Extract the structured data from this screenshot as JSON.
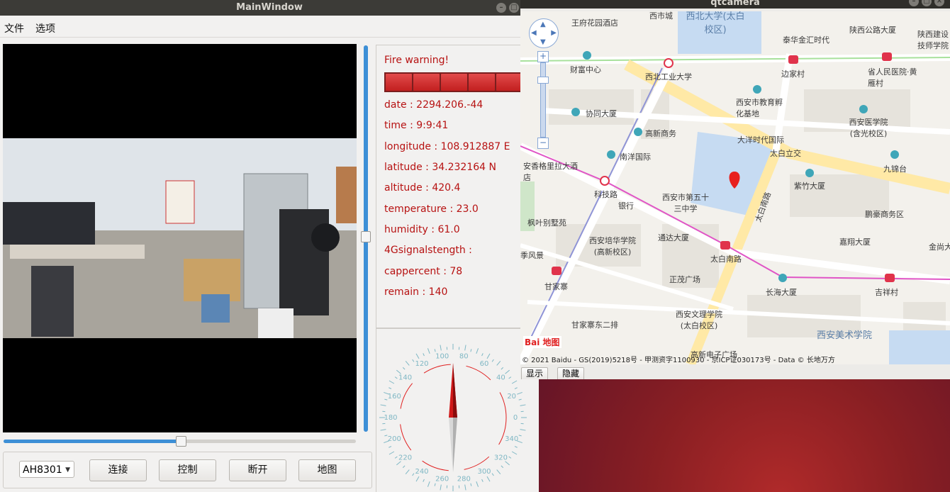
{
  "main_window": {
    "title": "MainWindow",
    "menu": [
      "文件",
      "选项"
    ],
    "info": {
      "fire_warning": "Fire warning!",
      "lines": [
        "date : 2294.206.-44",
        "time : 9:9:41",
        "longitude : 108.912887 E",
        "latitude : 34.232164 N",
        "altitude : 420.4",
        "temperature : 23.0",
        "humidity : 61.0",
        "4Gsignalstength :",
        "cappercent : 78",
        "remain : 140"
      ]
    },
    "device_select": "AH8301",
    "buttons": {
      "connect": "连接",
      "control": "控制",
      "disconnect": "断开",
      "map": "地图"
    },
    "compass": {
      "ticks": [
        "0",
        "20",
        "40",
        "60",
        "80",
        "100",
        "120",
        "140",
        "160",
        "180",
        "200",
        "220",
        "240",
        "260",
        "280",
        "300",
        "320",
        "340"
      ],
      "heading_deg": 0
    },
    "slider_h_fraction": 0.5,
    "slider_v_fraction": 1.0
  },
  "cam_window": {
    "title": "qtcamera",
    "map": {
      "labels": [
        "王府花园酒店",
        "西市城",
        "西北大学(太白校区)",
        "泰华金汇时代",
        "陕西公路大厦",
        "陕西建设技师学院",
        "财富中心",
        "西北工业大学",
        "边家村",
        "省人民医院·黄雁村",
        "西安市教育孵化基地",
        "协同大厦",
        "高新商务",
        "大洋时代国际",
        "西安医学院(含光校区)",
        "南洋国际",
        "太白立交",
        "九锦台",
        "安香格里拉大酒店",
        "科技路",
        "西安市第五十三中学",
        "紫竹大厦",
        "银行",
        "太白南路",
        "鹏豪商务区",
        "枫叶别墅苑",
        "通达大厦",
        "西安培华学院(高新校区)",
        "嘉翔大厦",
        "季风景",
        "太白南路",
        "甘家寨",
        "正茂广场",
        "长海大厦",
        "吉祥村",
        "西安文理学院(太白校区)",
        "甘家寨东二排",
        "西安美术学院",
        "高新电子广场",
        "金尚大"
      ],
      "copyright": "© 2021 Baidu - GS(2019)5218号 - 甲测资字1100930 - 京ICP证030173号 - Data © 长地万方",
      "logo": "Bai 地图"
    },
    "buttons": {
      "show": "显示",
      "hide": "隐藏"
    }
  },
  "colors": {
    "warning": "#b71212",
    "accent": "#3d8fd6",
    "metro": "#e0334b"
  }
}
